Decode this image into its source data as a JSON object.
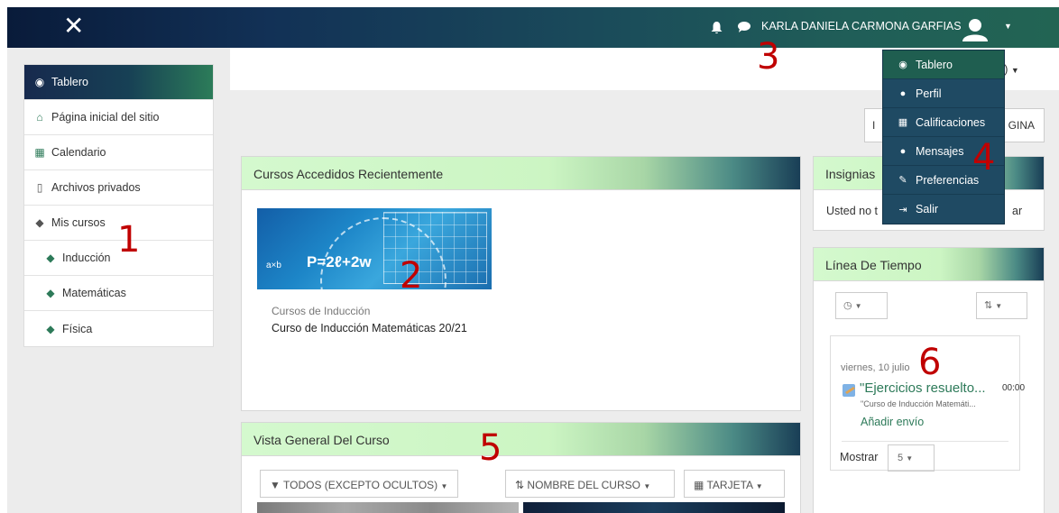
{
  "topbar": {
    "close_icon": "close-icon",
    "username": "KARLA DANIELA CARMONA GARFIAS"
  },
  "sidebar": {
    "items": [
      {
        "label": "Tablero",
        "icon": "dashboard-icon"
      },
      {
        "label": "Página inicial del sitio",
        "icon": "home-icon"
      },
      {
        "label": "Calendario",
        "icon": "calendar-icon"
      },
      {
        "label": "Archivos privados",
        "icon": "file-icon"
      },
      {
        "label": "Mis cursos",
        "icon": "graduation-cap-icon"
      },
      {
        "label": "Inducción",
        "icon": "graduation-cap-icon"
      },
      {
        "label": "Matemáticas",
        "icon": "graduation-cap-icon"
      },
      {
        "label": "Física",
        "icon": "graduation-cap-icon"
      }
    ]
  },
  "header": {
    "lang_label": "nx)",
    "page_button_label": "GINA",
    "page_button_prefix": "I"
  },
  "recent": {
    "title": "Cursos Accedidos Recientemente",
    "course_category": "Cursos de Inducción",
    "course_name": "Curso de Inducción Matemáticas 20/21",
    "image_formula": "P=2ℓ+2w"
  },
  "overview": {
    "title": "Vista General Del Curso",
    "filter_label": "TODOS (EXCEPTO OCULTOS)",
    "sort_label": "NOMBRE DEL CURSO",
    "view_label": "TARJETA"
  },
  "badges": {
    "title": "Insignias",
    "text_start": "Usted no t",
    "text_end": "ar"
  },
  "timeline": {
    "title": "Línea De Tiempo",
    "date": "viernes, 10 julio",
    "event_title": "\"Ejercicios resuelto...",
    "event_time": "00:00",
    "event_course": "\"Curso de Inducción Matemáti...",
    "action_link": "Añadir envío",
    "show_label": "Mostrar",
    "show_value": "5"
  },
  "user_menu": {
    "items": [
      {
        "label": "Tablero",
        "icon": "dashboard-icon"
      },
      {
        "label": "Perfil",
        "icon": "user-icon"
      },
      {
        "label": "Calificaciones",
        "icon": "table-icon"
      },
      {
        "label": "Mensajes",
        "icon": "comment-icon"
      },
      {
        "label": "Preferencias",
        "icon": "wrench-icon"
      },
      {
        "label": "Salir",
        "icon": "sign-out-icon"
      }
    ]
  },
  "annotations": [
    "1",
    "2",
    "3",
    "4",
    "5",
    "6"
  ]
}
